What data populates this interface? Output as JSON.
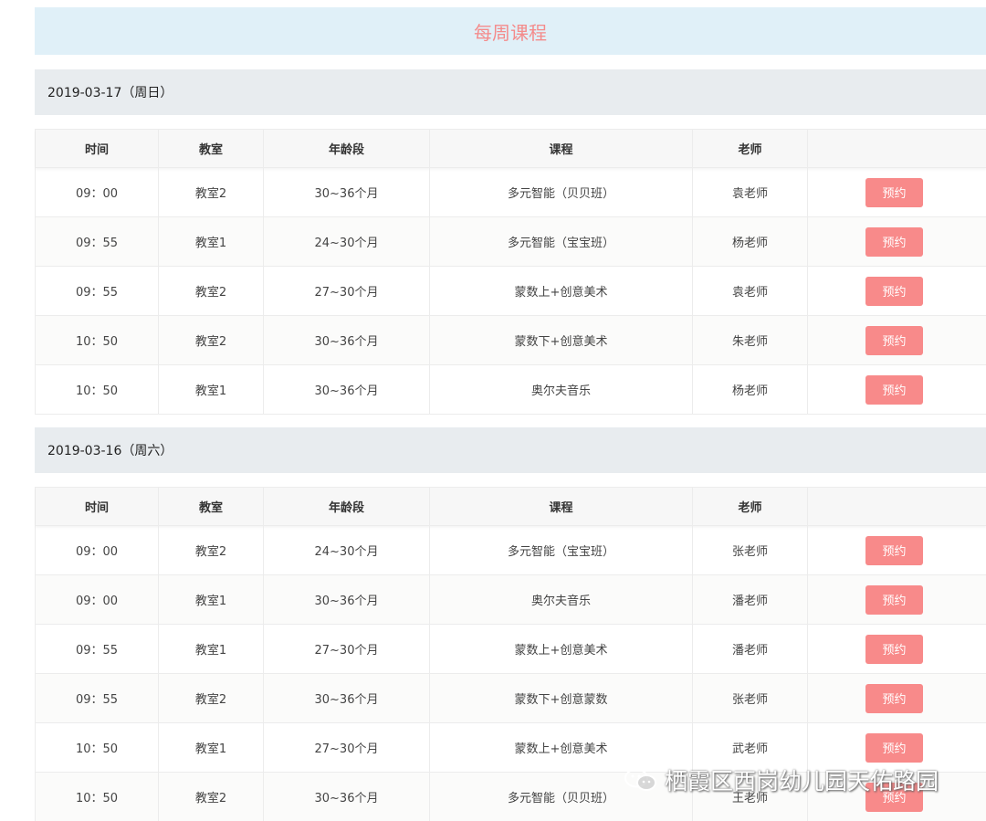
{
  "banner": {
    "title": "每周课程"
  },
  "columns": [
    "时间",
    "教室",
    "年龄段",
    "课程",
    "老师",
    ""
  ],
  "book_label": "预约",
  "days": [
    {
      "date": "2019-03-17（周日）",
      "rows": [
        [
          "09：00",
          "教室2",
          "30~36个月",
          "多元智能（贝贝班）",
          "袁老师"
        ],
        [
          "09：55",
          "教室1",
          "24~30个月",
          "多元智能（宝宝班）",
          "杨老师"
        ],
        [
          "09：55",
          "教室2",
          "27~30个月",
          "蒙数上+创意美术",
          "袁老师"
        ],
        [
          "10：50",
          "教室2",
          "30~36个月",
          "蒙数下+创意美术",
          "朱老师"
        ],
        [
          "10：50",
          "教室1",
          "30~36个月",
          "奥尔夫音乐",
          "杨老师"
        ]
      ]
    },
    {
      "date": "2019-03-16（周六）",
      "rows": [
        [
          "09：00",
          "教室2",
          "24~30个月",
          "多元智能（宝宝班）",
          "张老师"
        ],
        [
          "09：00",
          "教室1",
          "30~36个月",
          "奥尔夫音乐",
          "潘老师"
        ],
        [
          "09：55",
          "教室1",
          "27~30个月",
          "蒙数上+创意美术",
          "潘老师"
        ],
        [
          "09：55",
          "教室2",
          "30~36个月",
          "蒙数下+创意蒙数",
          "张老师"
        ],
        [
          "10：50",
          "教室1",
          "27~30个月",
          "蒙数上+创意美术",
          "武老师"
        ],
        [
          "10：50",
          "教室2",
          "30~36个月",
          "多元智能（贝贝班）",
          "王老师"
        ]
      ]
    }
  ],
  "watermark": {
    "text": "栖霞区西岗幼儿园天佑路园"
  },
  "colors": {
    "accent": "#f88a8a",
    "banner_bg": "#e0f0f8",
    "banner_text": "#f48b8b",
    "day_header_bg": "#e8ecef"
  }
}
